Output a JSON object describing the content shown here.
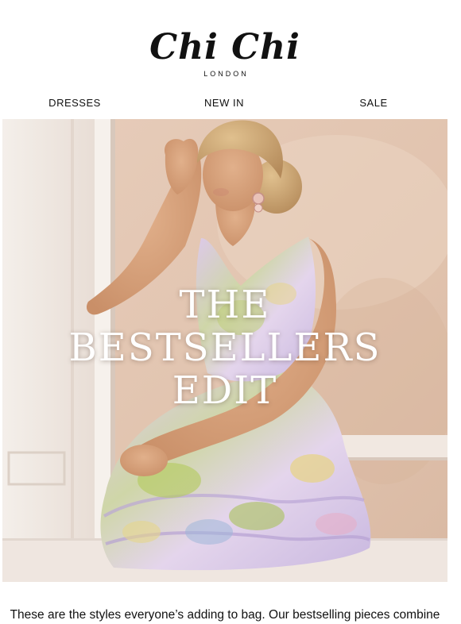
{
  "brand": {
    "name": "Chi Chi",
    "location": "LONDON"
  },
  "nav": {
    "items": [
      {
        "label": "DRESSES"
      },
      {
        "label": "NEW IN"
      },
      {
        "label": "SALE"
      }
    ]
  },
  "hero": {
    "title_lines": [
      "THE",
      "BESTSELLERS",
      "EDIT"
    ]
  },
  "intro": {
    "text": "These are the styles everyone’s adding to bag. Our bestselling pieces combine"
  },
  "colors": {
    "wall": "#e4c9b7",
    "door": "#f3ece6",
    "floor": "#efe6e0",
    "skin": "#d9a57f",
    "hair": "#caa474",
    "dress_lilac": "#d9c7e6",
    "dress_green": "#b9cc6a",
    "dress_yellow": "#e9d78c",
    "text": "#111111",
    "hero_text": "#ffffff"
  }
}
